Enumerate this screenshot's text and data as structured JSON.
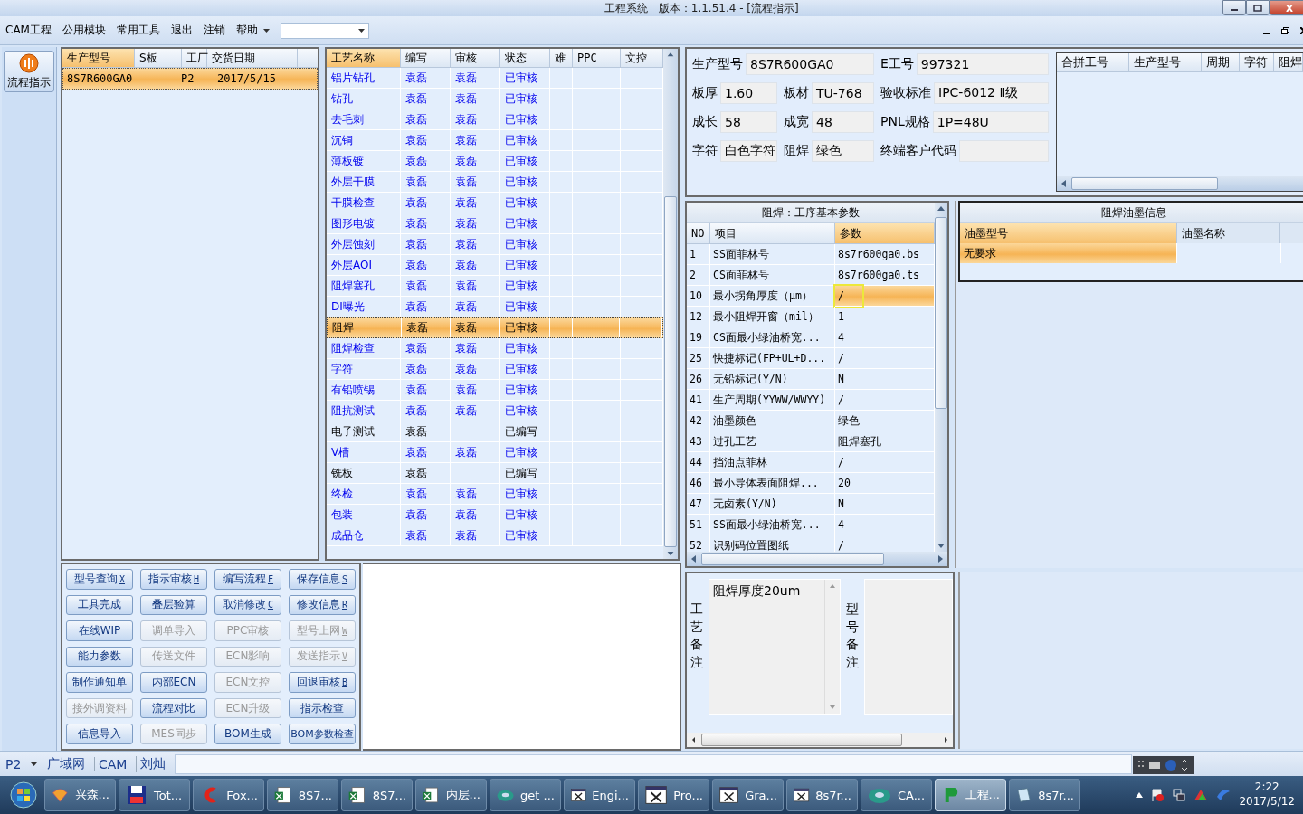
{
  "window": {
    "title": "工程系统   版本：1.1.51.4 - [流程指示]"
  },
  "menu": {
    "items": [
      "CAM工程",
      "公用模块",
      "常用工具",
      "退出",
      "注销",
      "帮助"
    ]
  },
  "side_button": {
    "label": "流程指示"
  },
  "order_list": {
    "columns": [
      "生产型号",
      "S板",
      "工厂",
      "交货日期"
    ],
    "rows": [
      {
        "model": "8S7R600GA0",
        "factory": "P2",
        "date": "2017/5/15",
        "selected": true
      }
    ]
  },
  "process_table": {
    "columns": [
      "工艺名称",
      "编写",
      "审核",
      "状态",
      "难",
      "PPC",
      "文控"
    ],
    "rows": [
      {
        "name": "铝片钻孔",
        "author": "袁磊",
        "reviewer": "袁磊",
        "status": "已审核",
        "approved": true,
        "selected": false
      },
      {
        "name": "钻孔",
        "author": "袁磊",
        "reviewer": "袁磊",
        "status": "已审核",
        "approved": true,
        "selected": false
      },
      {
        "name": "去毛刺",
        "author": "袁磊",
        "reviewer": "袁磊",
        "status": "已审核",
        "approved": true,
        "selected": false
      },
      {
        "name": "沉铜",
        "author": "袁磊",
        "reviewer": "袁磊",
        "status": "已审核",
        "approved": true,
        "selected": false
      },
      {
        "name": "薄板镀",
        "author": "袁磊",
        "reviewer": "袁磊",
        "status": "已审核",
        "approved": true,
        "selected": false
      },
      {
        "name": "外层干膜",
        "author": "袁磊",
        "reviewer": "袁磊",
        "status": "已审核",
        "approved": true,
        "selected": false
      },
      {
        "name": "干膜检查",
        "author": "袁磊",
        "reviewer": "袁磊",
        "status": "已审核",
        "approved": true,
        "selected": false
      },
      {
        "name": "图形电镀",
        "author": "袁磊",
        "reviewer": "袁磊",
        "status": "已审核",
        "approved": true,
        "selected": false
      },
      {
        "name": "外层蚀刻",
        "author": "袁磊",
        "reviewer": "袁磊",
        "status": "已审核",
        "approved": true,
        "selected": false
      },
      {
        "name": "外层AOI",
        "author": "袁磊",
        "reviewer": "袁磊",
        "status": "已审核",
        "approved": true,
        "selected": false
      },
      {
        "name": "阻焊塞孔",
        "author": "袁磊",
        "reviewer": "袁磊",
        "status": "已审核",
        "approved": true,
        "selected": false
      },
      {
        "name": "DI曝光",
        "author": "袁磊",
        "reviewer": "袁磊",
        "status": "已审核",
        "approved": true,
        "selected": false
      },
      {
        "name": "阻焊",
        "author": "袁磊",
        "reviewer": "袁磊",
        "status": "已审核",
        "approved": true,
        "selected": true
      },
      {
        "name": "阻焊检查",
        "author": "袁磊",
        "reviewer": "袁磊",
        "status": "已审核",
        "approved": true,
        "selected": false
      },
      {
        "name": "字符",
        "author": "袁磊",
        "reviewer": "袁磊",
        "status": "已审核",
        "approved": true,
        "selected": false
      },
      {
        "name": "有铅喷锡",
        "author": "袁磊",
        "reviewer": "袁磊",
        "status": "已审核",
        "approved": true,
        "selected": false
      },
      {
        "name": "阻抗测试",
        "author": "袁磊",
        "reviewer": "袁磊",
        "status": "已审核",
        "approved": true,
        "selected": false
      },
      {
        "name": "电子测试",
        "author": "袁磊",
        "status": "已编写",
        "approved": false,
        "selected": false
      },
      {
        "name": "V槽",
        "author": "袁磊",
        "reviewer": "袁磊",
        "status": "已审核",
        "approved": true,
        "selected": false
      },
      {
        "name": "铣板",
        "author": "袁磊",
        "status": "已编写",
        "approved": false,
        "selected": false
      },
      {
        "name": "终检",
        "author": "袁磊",
        "reviewer": "袁磊",
        "status": "已审核",
        "approved": true,
        "selected": false
      },
      {
        "name": "包装",
        "author": "袁磊",
        "reviewer": "袁磊",
        "status": "已审核",
        "approved": true,
        "selected": false
      },
      {
        "name": "成品仓",
        "author": "袁磊",
        "reviewer": "袁磊",
        "status": "已审核",
        "approved": true,
        "selected": false
      }
    ]
  },
  "buttons": [
    {
      "label": "型号查询",
      "key": "X",
      "disabled": false
    },
    {
      "label": "指示审核",
      "key": "H",
      "disabled": false
    },
    {
      "label": "编写流程",
      "key": "F",
      "disabled": false
    },
    {
      "label": "保存信息",
      "key": "S",
      "disabled": false
    },
    {
      "label": "工具完成",
      "disabled": false
    },
    {
      "label": "叠层验算",
      "disabled": false
    },
    {
      "label": "取消修改",
      "key": "C",
      "disabled": false
    },
    {
      "label": "修改信息",
      "key": "R",
      "disabled": false
    },
    {
      "label": "在线WIP",
      "disabled": false
    },
    {
      "label": "调单导入",
      "disabled": true
    },
    {
      "label": "PPC审核",
      "disabled": true
    },
    {
      "label": "型号上网",
      "key": "W",
      "disabled": true
    },
    {
      "label": "能力参数",
      "disabled": false
    },
    {
      "label": "传送文件",
      "disabled": true
    },
    {
      "label": "ECN影响",
      "disabled": true
    },
    {
      "label": "发送指示",
      "key": "V",
      "disabled": true
    },
    {
      "label": "制作通知单",
      "disabled": false
    },
    {
      "label": "内部ECN",
      "disabled": false
    },
    {
      "label": "ECN文控",
      "disabled": true
    },
    {
      "label": "回退审核",
      "key": "B",
      "disabled": false
    },
    {
      "label": "接外调资料",
      "disabled": true
    },
    {
      "label": "流程对比",
      "disabled": false
    },
    {
      "label": "ECN升级",
      "disabled": true
    },
    {
      "label": "指示检查",
      "disabled": false
    },
    {
      "label": "信息导入",
      "disabled": false
    },
    {
      "label": "MES同步",
      "disabled": true
    },
    {
      "label": "BOM生成",
      "disabled": false
    },
    {
      "label": "BOM参数检查",
      "disabled": false
    }
  ],
  "info": {
    "fields": [
      {
        "label": "生产型号",
        "value": "8S7R600GA0"
      },
      {
        "label": "E工号",
        "value": "997321"
      },
      {
        "label": "板厚",
        "value": "1.60"
      },
      {
        "label": "板材",
        "value": "TU-768"
      },
      {
        "label": "验收标准",
        "value": "IPC-6012 Ⅱ级"
      },
      {
        "label": "成长",
        "value": "58"
      },
      {
        "label": "成宽",
        "value": "48"
      },
      {
        "label": "PNL规格",
        "value": "1P=48U"
      },
      {
        "label": "字符",
        "value": "白色字符"
      },
      {
        "label": "阻焊",
        "value": "绿色"
      },
      {
        "label": "终端客户代码"
      }
    ]
  },
  "merge_table": {
    "columns": [
      "合拼工号",
      "生产型号",
      "周期",
      "字符",
      "阻焊"
    ]
  },
  "params": {
    "title": "阻焊：工序基本参数",
    "columns": [
      "NO",
      "项目",
      "参数"
    ],
    "rows": [
      {
        "no": "1",
        "item": "SS面菲林号",
        "value": "8s7r600ga0.bs",
        "selected": false
      },
      {
        "no": "2",
        "item": "CS面菲林号",
        "value": "8s7r600ga0.ts",
        "selected": false
      },
      {
        "no": "10",
        "item": "最小拐角厚度（μm）",
        "value": "/",
        "selected": true
      },
      {
        "no": "12",
        "item": "最小阻焊开窗（mil）",
        "value": "1",
        "selected": false
      },
      {
        "no": "19",
        "item": "CS面最小绿油桥宽...",
        "value": "4",
        "selected": false
      },
      {
        "no": "25",
        "item": "快捷标记(FP+UL+D...",
        "value": "/",
        "selected": false
      },
      {
        "no": "26",
        "item": "无铅标记(Y/N)",
        "value": "N",
        "selected": false
      },
      {
        "no": "41",
        "item": "生产周期(YYWW/WWYY)",
        "value": "/",
        "selected": false
      },
      {
        "no": "42",
        "item": "油墨颜色",
        "value": "绿色",
        "selected": false
      },
      {
        "no": "43",
        "item": "过孔工艺",
        "value": "阻焊塞孔",
        "selected": false
      },
      {
        "no": "44",
        "item": "挡油点菲林",
        "value": "/",
        "selected": false
      },
      {
        "no": "46",
        "item": "最小导体表面阻焊...",
        "value": "20",
        "selected": false
      },
      {
        "no": "47",
        "item": "无卤素(Y/N)",
        "value": "N",
        "selected": false
      },
      {
        "no": "51",
        "item": "SS面最小绿油桥宽...",
        "value": "4",
        "selected": false
      },
      {
        "no": "52",
        "item": "识别码位置图纸",
        "value": "/",
        "selected": false
      }
    ]
  },
  "ink": {
    "title": "阻焊油墨信息",
    "columns": [
      "油墨型号",
      "油墨名称"
    ],
    "rows": [
      {
        "type": "无要求",
        "selected": true
      }
    ]
  },
  "remarks": {
    "process_label": "工艺备注",
    "process_text": "阻焊厚度20um",
    "model_label": "型号备注"
  },
  "status_bar": {
    "factory": "P2",
    "items": [
      "广域网",
      "CAM",
      "刘灿"
    ]
  },
  "taskbar": {
    "items": [
      {
        "label": "兴森...",
        "kind": "shell",
        "selected": false
      },
      {
        "label": "Tot...",
        "kind": "floppy",
        "selected": false
      },
      {
        "label": "Fox...",
        "kind": "fox",
        "selected": false
      },
      {
        "label": "8S7...",
        "kind": "sheet",
        "selected": false
      },
      {
        "label": "8S7...",
        "kind": "sheet",
        "selected": false
      },
      {
        "label": "内层...",
        "kind": "sheet",
        "selected": false
      },
      {
        "label": "get ...",
        "kind": "disc",
        "selected": false
      },
      {
        "label": "Engi...",
        "kind": "xwin",
        "selected": false
      },
      {
        "label": "Pro...",
        "kind": "xwin",
        "selected": false
      },
      {
        "label": "Gra...",
        "kind": "xwin",
        "selected": false
      },
      {
        "label": "8s7r...",
        "kind": "xwin",
        "selected": false
      },
      {
        "label": "CA...",
        "kind": "disc",
        "selected": false
      },
      {
        "label": "工程...",
        "kind": "pcb",
        "selected": true
      },
      {
        "label": "8s7r...",
        "kind": "note",
        "selected": false
      }
    ],
    "time": "2:22",
    "date": "2017/5/12"
  }
}
